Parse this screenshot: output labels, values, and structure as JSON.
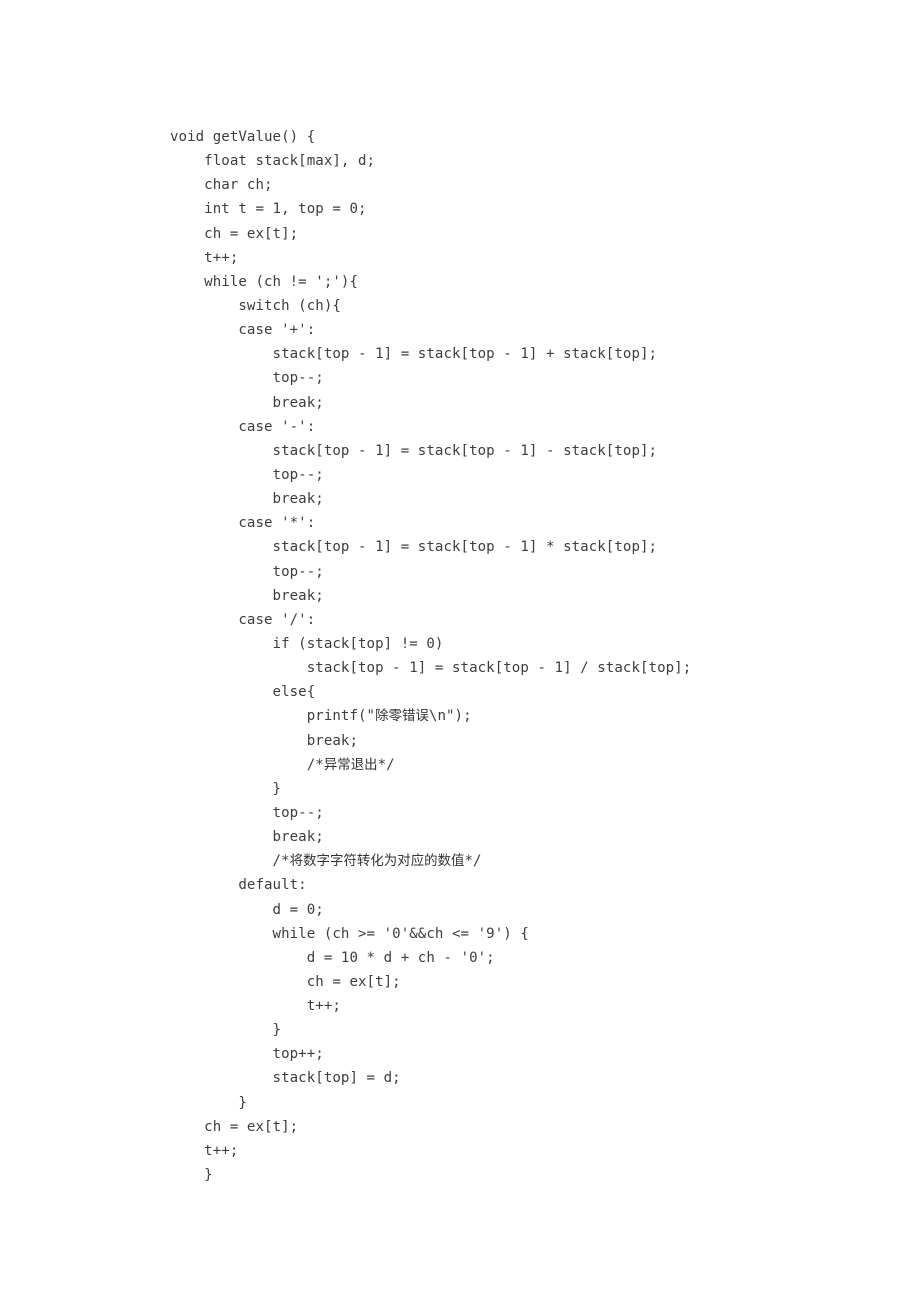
{
  "document": {
    "type": "code-listing",
    "language": "C",
    "function_name": "getValue",
    "ink_color": "#3a3a3a",
    "page_background": "#ffffff",
    "line_count": 44,
    "indent_unit_spaces": 4
  },
  "code": {
    "lines": [
      {
        "indent": 0,
        "text": "void getValue() {"
      },
      {
        "indent": 1,
        "text": "float stack[max], d;"
      },
      {
        "indent": 1,
        "text": "char ch;"
      },
      {
        "indent": 1,
        "text": "int t = 1, top = 0;"
      },
      {
        "indent": 1,
        "text": "ch = ex[t];"
      },
      {
        "indent": 1,
        "text": "t++;"
      },
      {
        "indent": 1,
        "text": "while (ch != ';'){"
      },
      {
        "indent": 2,
        "text": "switch (ch){"
      },
      {
        "indent": 2,
        "text": "case '+':"
      },
      {
        "indent": 3,
        "text": "stack[top - 1] = stack[top - 1] + stack[top];"
      },
      {
        "indent": 3,
        "text": "top--;"
      },
      {
        "indent": 3,
        "text": "break;"
      },
      {
        "indent": 2,
        "text": "case '-':"
      },
      {
        "indent": 3,
        "text": "stack[top - 1] = stack[top - 1] - stack[top];"
      },
      {
        "indent": 3,
        "text": "top--;"
      },
      {
        "indent": 3,
        "text": "break;"
      },
      {
        "indent": 2,
        "text": "case '*':"
      },
      {
        "indent": 3,
        "text": "stack[top - 1] = stack[top - 1] * stack[top];"
      },
      {
        "indent": 3,
        "text": "top--;"
      },
      {
        "indent": 3,
        "text": "break;"
      },
      {
        "indent": 2,
        "text": "case '/':"
      },
      {
        "indent": 3,
        "text": "if (stack[top] != 0)"
      },
      {
        "indent": 4,
        "text": "stack[top - 1] = stack[top - 1] / stack[top];"
      },
      {
        "indent": 3,
        "text": "else{"
      },
      {
        "indent": 4,
        "text": "printf(\"除零错误\\n\");"
      },
      {
        "indent": 4,
        "text": "break;"
      },
      {
        "indent": 4,
        "text": "/*异常退出*/"
      },
      {
        "indent": 3,
        "text": "}"
      },
      {
        "indent": 3,
        "text": "top--;"
      },
      {
        "indent": 3,
        "text": "break;"
      },
      {
        "indent": 3,
        "text": "/*将数字字符转化为对应的数值*/"
      },
      {
        "indent": 2,
        "text": "default:"
      },
      {
        "indent": 3,
        "text": "d = 0;"
      },
      {
        "indent": 3,
        "text": "while (ch >= '0'&&ch <= '9') {"
      },
      {
        "indent": 4,
        "text": "d = 10 * d + ch - '0';"
      },
      {
        "indent": 4,
        "text": "ch = ex[t];"
      },
      {
        "indent": 4,
        "text": "t++;"
      },
      {
        "indent": 3,
        "text": "}"
      },
      {
        "indent": 3,
        "text": "top++;"
      },
      {
        "indent": 3,
        "text": "stack[top] = d;"
      },
      {
        "indent": 2,
        "text": "}"
      },
      {
        "indent": 1,
        "text": "ch = ex[t];"
      },
      {
        "indent": 1,
        "text": "t++;"
      },
      {
        "indent": 1,
        "text": "}"
      }
    ]
  }
}
